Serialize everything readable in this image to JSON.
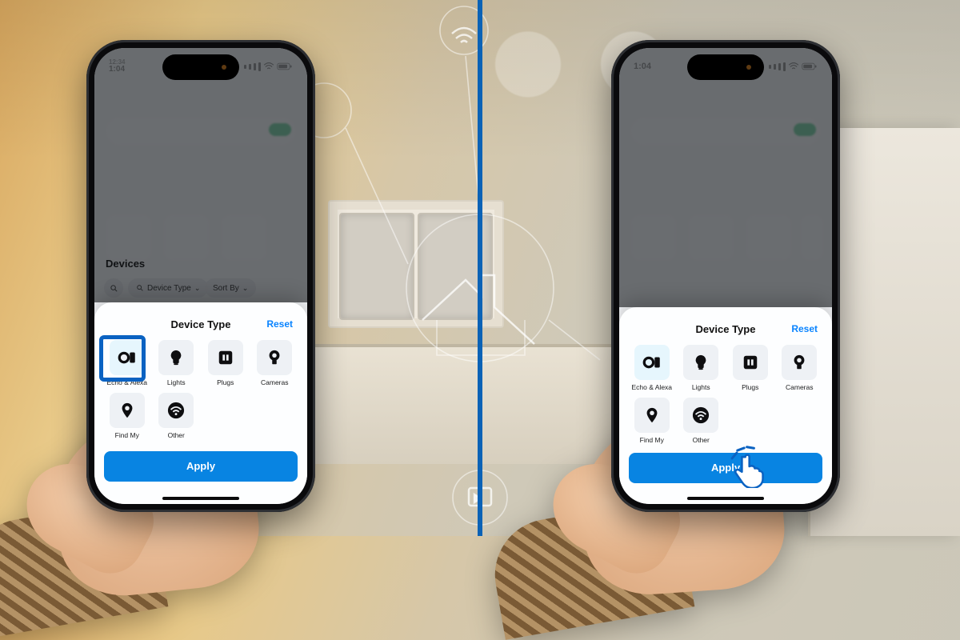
{
  "status": {
    "time_left": "1:04",
    "time_right": "1:04"
  },
  "dim_screen": {
    "devices_heading": "Devices",
    "device_type_chip": "Device Type",
    "sort_by_chip": "Sort By"
  },
  "sheet": {
    "title": "Device Type",
    "reset": "Reset",
    "apply": "Apply",
    "tiles": [
      {
        "label": "Echo & Alexa",
        "icon": "echo-alexa-icon"
      },
      {
        "label": "Lights",
        "icon": "bulb-icon"
      },
      {
        "label": "Plugs",
        "icon": "plug-icon"
      },
      {
        "label": "Cameras",
        "icon": "camera-icon"
      },
      {
        "label": "Find My",
        "icon": "location-pin-icon"
      },
      {
        "label": "Other",
        "icon": "wifi-icon"
      }
    ]
  },
  "colors": {
    "accent": "#0884e2",
    "highlight": "#0a62c2",
    "divider": "#0a62b6"
  }
}
